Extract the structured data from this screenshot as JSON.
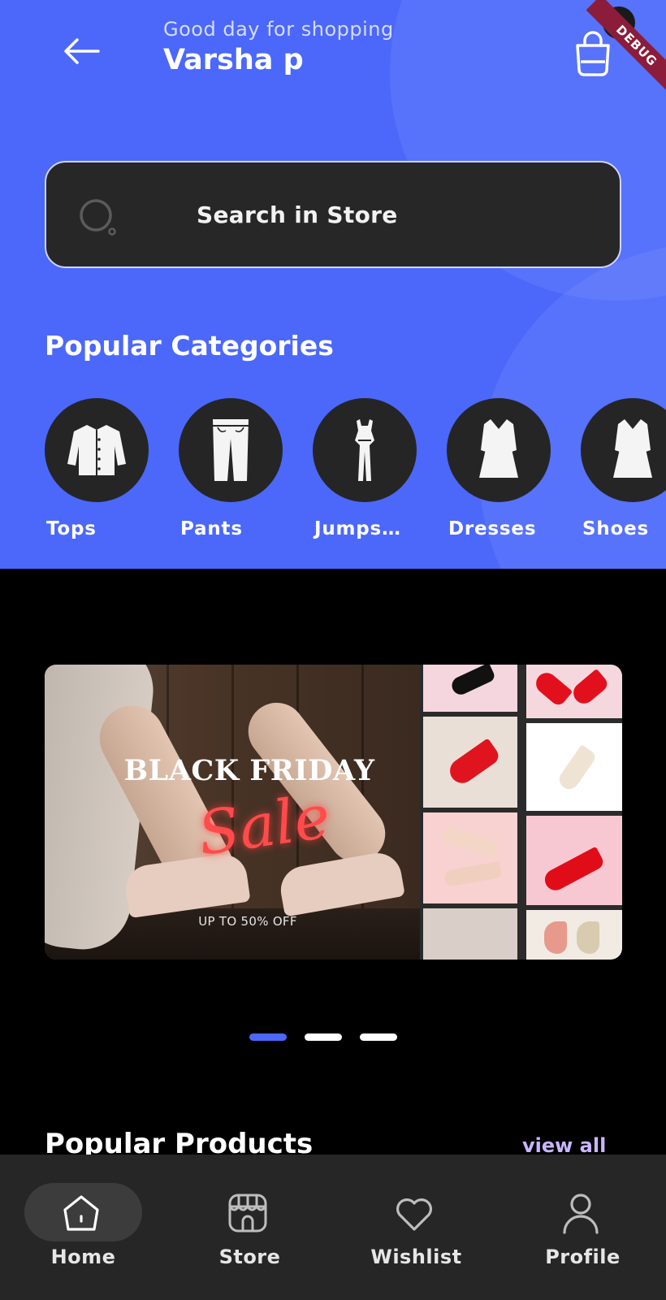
{
  "header": {
    "greeting": "Good day for shopping",
    "username": "Varsha p",
    "cart_count": "0",
    "debug_ribbon": "DEBUG"
  },
  "search": {
    "placeholder": "Search in Store"
  },
  "popular_categories": {
    "title": "Popular Categories",
    "items": [
      {
        "label": "Tops",
        "icon": "shirt-icon"
      },
      {
        "label": "Pants",
        "icon": "pants-icon"
      },
      {
        "label": "Jumps…",
        "icon": "jumpsuit-icon"
      },
      {
        "label": "Dresses",
        "icon": "dress-icon"
      },
      {
        "label": "Shoes",
        "icon": "dress-icon"
      }
    ]
  },
  "banner": {
    "title": "BLACK FRIDAY",
    "script": "Sale",
    "offer": "UP TO 50% OFF",
    "slides": 3,
    "active_slide": 1
  },
  "popular_products": {
    "title": "Popular Products",
    "view_all": "view all"
  },
  "bottom_nav": {
    "items": [
      {
        "label": "Home",
        "icon": "home-icon",
        "active": true
      },
      {
        "label": "Store",
        "icon": "store-icon",
        "active": false
      },
      {
        "label": "Wishlist",
        "icon": "heart-icon",
        "active": false
      },
      {
        "label": "Profile",
        "icon": "user-icon",
        "active": false
      }
    ]
  },
  "colors": {
    "primary": "#4b68fb",
    "dark": "#000000",
    "surface": "#262626",
    "accent_text": "#c9b6ff"
  }
}
